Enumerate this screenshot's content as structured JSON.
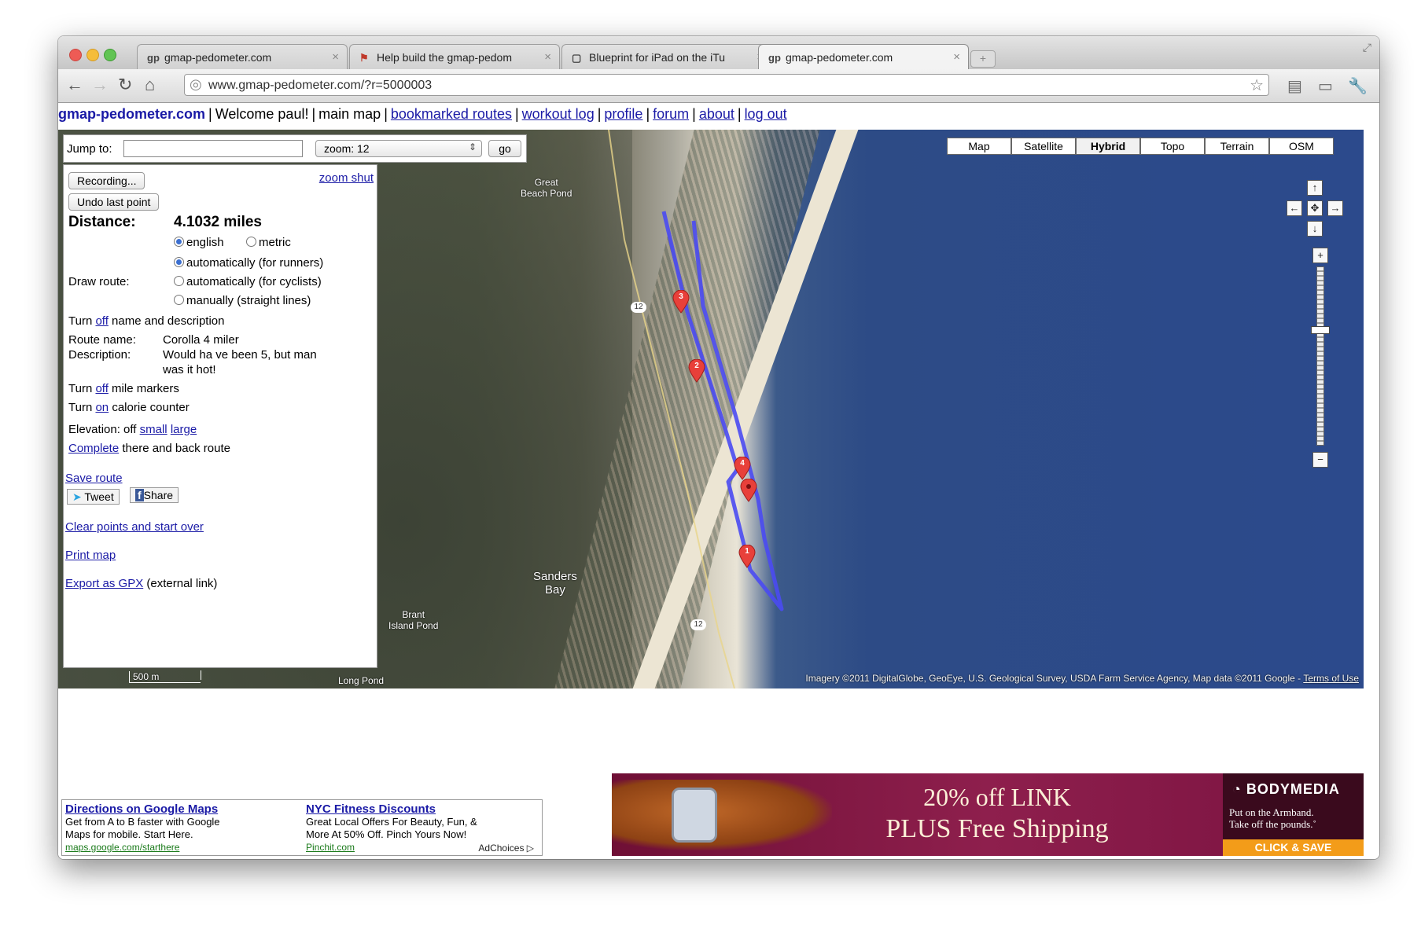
{
  "tabs": [
    {
      "favicon": "gp",
      "title": "gmap-pedometer.com",
      "active": false
    },
    {
      "favicon": "flag-icon",
      "title": "Help build the gmap-pedom",
      "active": false
    },
    {
      "favicon": "doc-icon",
      "title": "Blueprint for iPad on the iTu",
      "active": false
    },
    {
      "favicon": "gp",
      "title": "gmap-pedometer.com",
      "active": true
    }
  ],
  "address": {
    "url": "www.gmap-pedometer.com/?r=5000003"
  },
  "nav": {
    "site": "gmap-pedometer.com",
    "welcome": "Welcome paul!",
    "main_map": "main map",
    "links": [
      "bookmarked routes",
      "workout log",
      "profile",
      "forum",
      "about",
      "log out"
    ]
  },
  "jump": {
    "label": "Jump to:",
    "value": "",
    "zoom": "zoom: 12",
    "go": "go"
  },
  "panel": {
    "recording": "Recording...",
    "undo": "Undo last point",
    "zoom_shut": "zoom shut",
    "distance_label": "Distance:",
    "distance_value": "4.1032 miles",
    "units": {
      "english": "english",
      "metric": "metric",
      "selected": "english"
    },
    "draw_route_label": "Draw route:",
    "draw_options": [
      "automatically (for runners)",
      "automatically (for cyclists)",
      "manually (straight lines)"
    ],
    "draw_selected": 0,
    "turn_prefix": "Turn",
    "name_toggle": {
      "link": "off",
      "text": "name and description"
    },
    "route_name_label": "Route name:",
    "route_name": "Corolla 4 miler",
    "description_label": "Description:",
    "description_1": "Would ha ve been 5, but man",
    "description_2": "was it hot!",
    "mile_markers": {
      "link": "off",
      "text": "mile markers"
    },
    "calorie": {
      "link": "on",
      "text": "calorie counter"
    },
    "elevation": {
      "label": "Elevation: off",
      "small": "small",
      "large": "large"
    },
    "complete": {
      "link": "Complete",
      "text": "there and back route"
    },
    "save_route": "Save route",
    "tweet": "Tweet",
    "share": "Share",
    "clear": "Clear points and start over",
    "print": "Print map",
    "export": {
      "link": "Export as GPX",
      "text": "(external link)"
    }
  },
  "map": {
    "types": [
      "Map",
      "Satellite",
      "Hybrid",
      "Topo",
      "Terrain",
      "OSM"
    ],
    "active_type": "Hybrid",
    "labels": {
      "great_beach_pond_1": "Great",
      "great_beach_pond_2": "Beach Pond",
      "sanders_1": "Sanders",
      "sanders_2": "Bay",
      "brant_1": "Brant",
      "brant_2": "Island Pond",
      "long_pond": "Long Pond",
      "road_12": "12"
    },
    "markers": [
      "1",
      "2",
      "3",
      "4"
    ],
    "scale": "500 m",
    "attribution": "Imagery ©2011 DigitalGlobe, GeoEye, U.S. Geological Survey, USDA Farm Service Agency, Map data ©2011 Google -",
    "terms": "Terms of Use",
    "controls": {
      "up": "↑",
      "down": "↓",
      "left": "←",
      "right": "→",
      "center": "✥",
      "zoom_in": "+",
      "zoom_out": "−"
    }
  },
  "ads": [
    {
      "title": "Directions on Google Maps",
      "line1": "Get from A to B faster with Google",
      "line2": "Maps for mobile. Start Here.",
      "url": "maps.google.com/starthere"
    },
    {
      "title": "NYC Fitness Discounts",
      "line1": "Great Local Offers For Beauty, Fun, &",
      "line2": "More At 50% Off. Pinch Yours Now!",
      "url": "Pinchit.com"
    }
  ],
  "adchoices": "AdChoices ▷",
  "banner": {
    "line1": "20% off LINK",
    "line2": "PLUS Free Shipping",
    "logo": "BODYMEDIA",
    "tag1": "Put on the Armband.",
    "tag2": "Take off the pounds.˚",
    "cta": "CLICK & SAVE"
  }
}
